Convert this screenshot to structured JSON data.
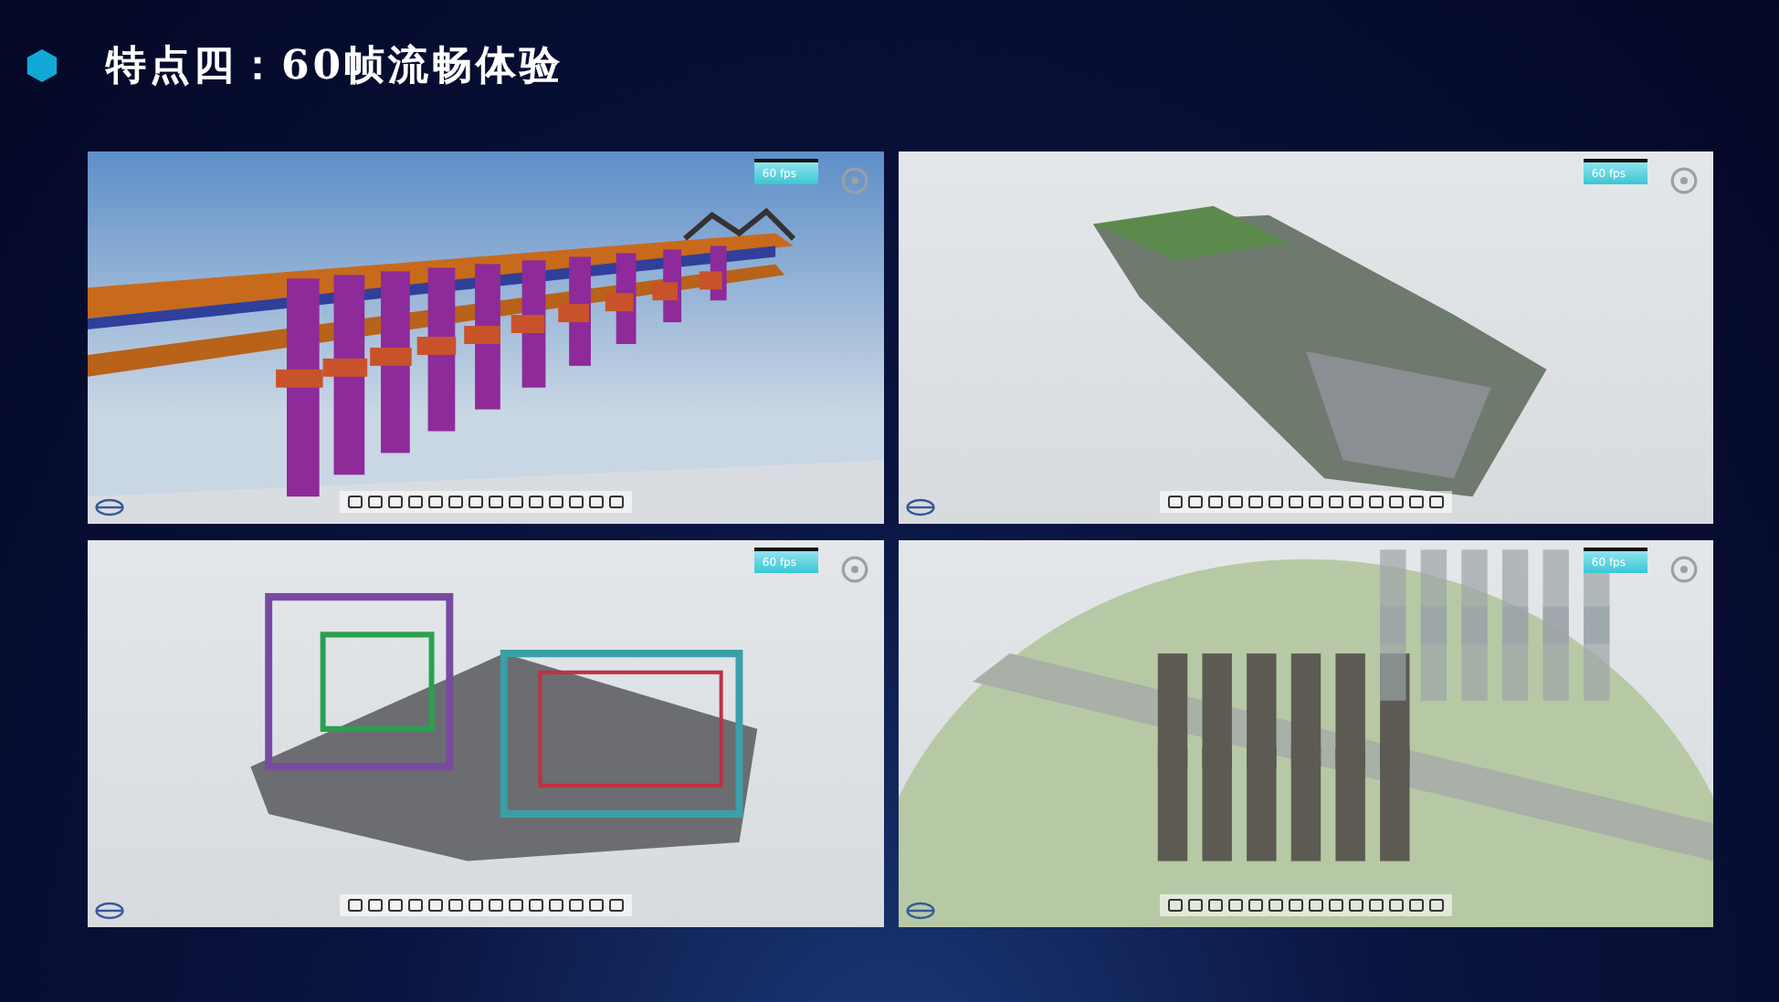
{
  "title": "特点四：60帧流畅体验",
  "viewports": [
    {
      "kind": "bridge",
      "fps": "60 fps"
    },
    {
      "kind": "city",
      "fps": "60 fps"
    },
    {
      "kind": "building",
      "fps": "60 fps"
    },
    {
      "kind": "residential",
      "fps": "60 fps"
    }
  ]
}
